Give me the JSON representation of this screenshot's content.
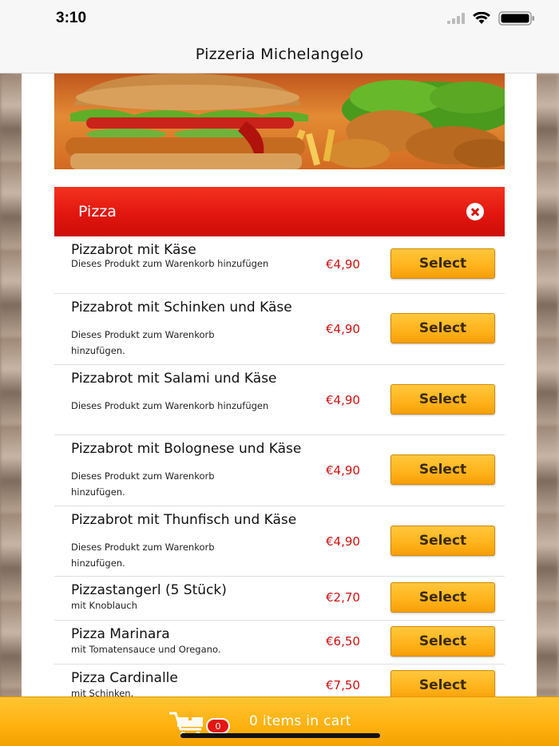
{
  "status_bar": {
    "time": "3:10"
  },
  "nav": {
    "title": "Pizzeria Michelangelo"
  },
  "category": {
    "title": "Pizza"
  },
  "items": [
    {
      "name": "Pizzabrot mit Käse",
      "desc": "Dieses Produkt zum Warenkorb hinzufügen",
      "price": "€4,90",
      "button": "Select"
    },
    {
      "name": "Pizzabrot mit Schinken und Käse",
      "desc": "Dieses Produkt zum Warenkorb hinzufügen.",
      "price": "€4,90",
      "button": "Select"
    },
    {
      "name": "Pizzabrot mit Salami und Käse",
      "desc": "Dieses Produkt zum Warenkorb hinzufügen",
      "price": "€4,90",
      "button": "Select"
    },
    {
      "name": "Pizzabrot mit Bolognese und Käse",
      "desc": "Dieses Produkt zum Warenkorb hinzufügen.",
      "price": "€4,90",
      "button": "Select"
    },
    {
      "name": "Pizzabrot mit Thunfisch und Käse",
      "desc": "Dieses Produkt zum Warenkorb hinzufügen.",
      "price": "€4,90",
      "button": "Select"
    },
    {
      "name": "Pizzastangerl (5 Stück)",
      "desc": "mit Knoblauch",
      "price": "€2,70",
      "button": "Select"
    },
    {
      "name": "Pizza Marinara",
      "desc": "mit Tomatensauce und Oregano.",
      "price": "€6,50",
      "button": "Select"
    },
    {
      "name": "Pizza Cardinalle",
      "desc": "mit Schinken.",
      "price": "€7,50",
      "button": "Select"
    }
  ],
  "cart": {
    "count": "0",
    "label": "0 items in cart"
  },
  "colors": {
    "accent_red": "#e2160f",
    "button_yellow": "#ffb21a",
    "price_red": "#cf1010"
  },
  "icons": {
    "close": "close-circle-icon",
    "cart": "cart-add-icon",
    "wifi": "wifi-icon",
    "battery": "battery-icon",
    "signal": "signal-icon"
  }
}
